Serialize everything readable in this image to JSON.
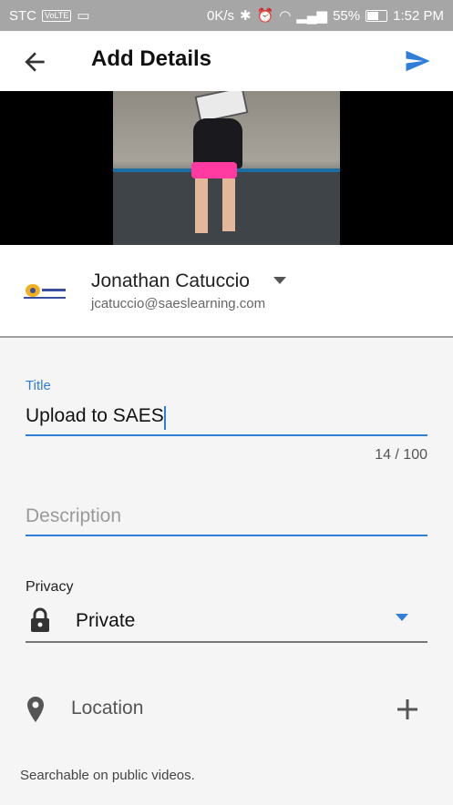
{
  "status_bar": {
    "carrier": "STC",
    "network_chip": "VoLTE",
    "speed": "0K/s",
    "battery": "55%",
    "time": "1:52 PM"
  },
  "app_bar": {
    "title": "Add Details"
  },
  "account": {
    "name": "Jonathan Catuccio",
    "email": "jcatuccio@saeslearning.com"
  },
  "form": {
    "title_label": "Title",
    "title_value": "Upload to SAES",
    "counter": "14 / 100",
    "description_placeholder": "Description",
    "privacy_label": "Privacy",
    "privacy_value": "Private",
    "location_label": "Location",
    "searchable_note": "Searchable on public videos."
  },
  "colors": {
    "accent": "#2f7fd8",
    "status_bar": "#a6a6a6"
  },
  "icons": [
    "back-arrow-icon",
    "send-icon",
    "dropdown-caret-icon",
    "lock-icon",
    "location-pin-icon",
    "plus-icon"
  ]
}
